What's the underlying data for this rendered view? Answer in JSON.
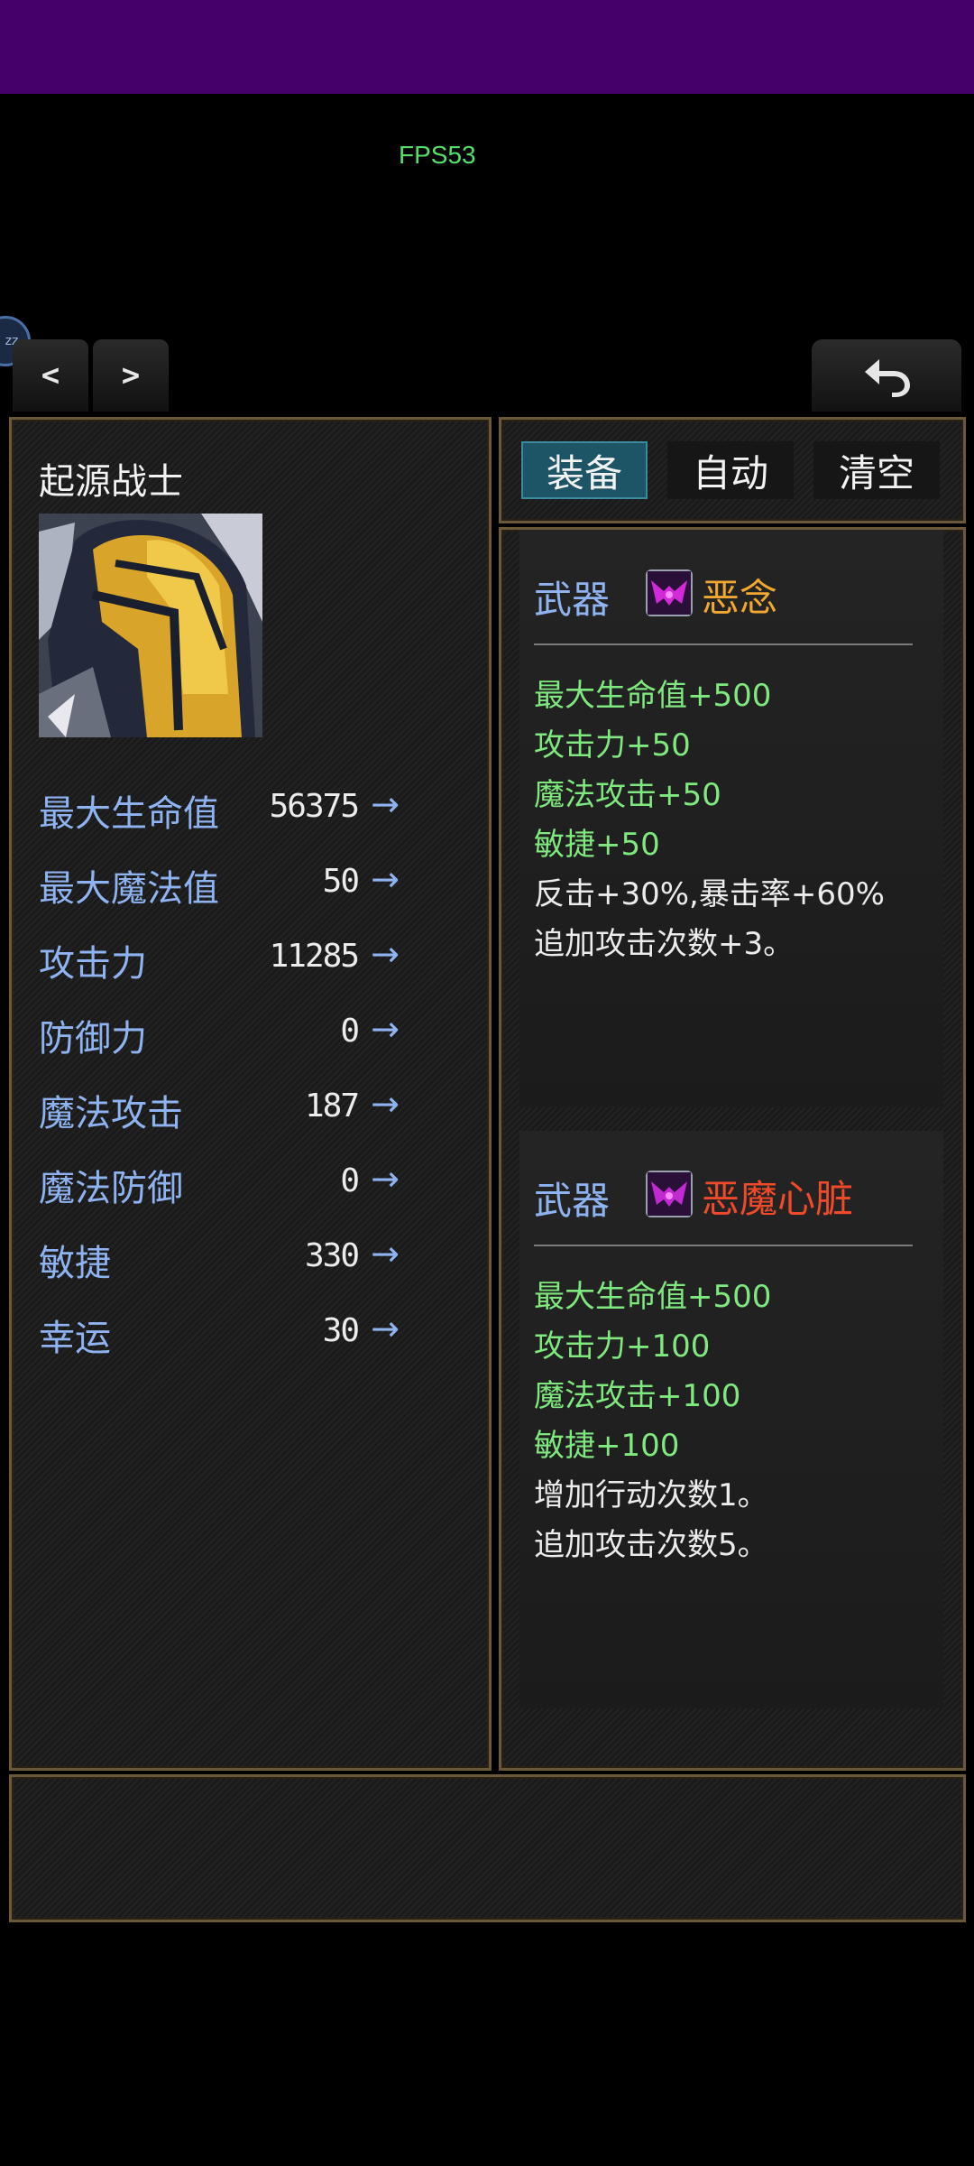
{
  "status": {
    "fps": "FPS53"
  },
  "nav": {
    "avatar_text": "zz",
    "prev_label": "<",
    "next_label": ">"
  },
  "hero": {
    "name": "起源战士",
    "stats": [
      {
        "label": "最大生命值",
        "value": "56375",
        "arrow": "→"
      },
      {
        "label": "最大魔法值",
        "value": "50",
        "arrow": "→"
      },
      {
        "label": "攻击力",
        "value": "11285",
        "arrow": "→"
      },
      {
        "label": "防御力",
        "value": "0",
        "arrow": "→"
      },
      {
        "label": "魔法攻击",
        "value": "187",
        "arrow": "→"
      },
      {
        "label": "魔法防御",
        "value": "0",
        "arrow": "→"
      },
      {
        "label": "敏捷",
        "value": "330",
        "arrow": "→"
      },
      {
        "label": "幸运",
        "value": "30",
        "arrow": "→"
      }
    ]
  },
  "tabs": [
    {
      "label": "装备",
      "active": true
    },
    {
      "label": "自动",
      "active": false
    },
    {
      "label": "清空",
      "active": false
    }
  ],
  "equipment": [
    {
      "type": "武器",
      "name": "恶念",
      "name_color": "#f0a830",
      "bonuses": [
        "最大生命值+500",
        "攻击力+50",
        "魔法攻击+50",
        "敏捷+50"
      ],
      "effects": [
        "反击+30%,暴击率+60%",
        "追加攻击次数+3。"
      ]
    },
    {
      "type": "武器",
      "name": "恶魔心脏",
      "name_color": "#f04a2a",
      "bonuses": [
        "最大生命值+500",
        "攻击力+100",
        "魔法攻击+100",
        "敏捷+100"
      ],
      "effects": [
        "增加行动次数1。",
        "追加攻击次数5。"
      ]
    }
  ],
  "colors": {
    "status_bar": "#46006a",
    "fps_text": "#54e06a",
    "stat_label": "#8fb3f0",
    "bonus_text": "#7fe87f",
    "frame": "#6b5838",
    "active_tab": "#1e5566"
  }
}
